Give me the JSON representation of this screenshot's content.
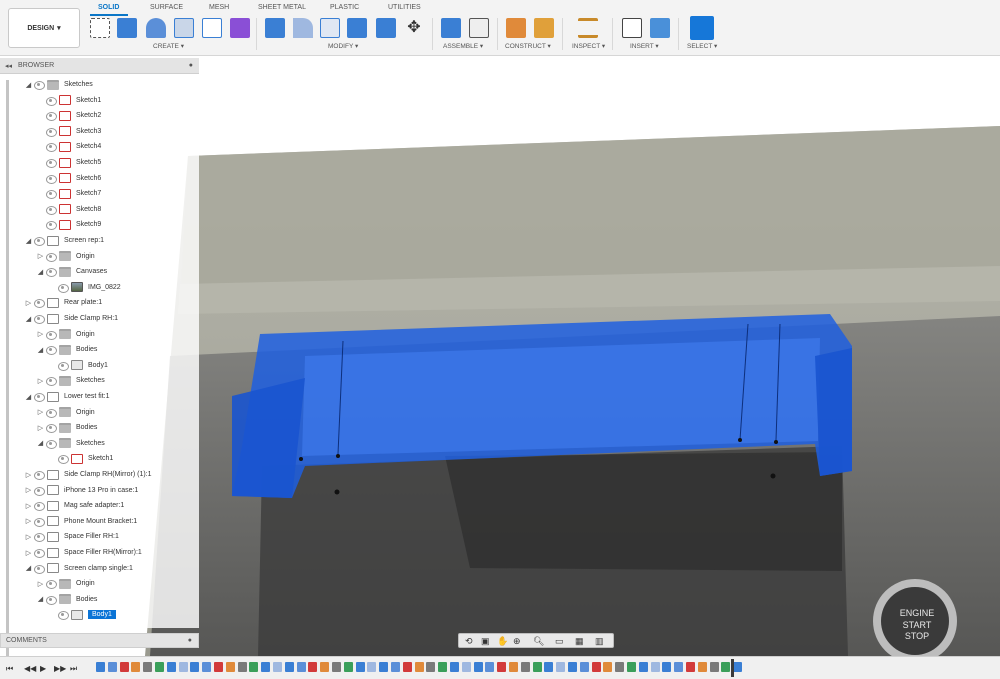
{
  "toolbar": {
    "workspace": "DESIGN",
    "tabs": [
      "SOLID",
      "SURFACE",
      "MESH",
      "SHEET METAL",
      "PLASTIC",
      "UTILITIES"
    ],
    "active_tab": "SOLID",
    "groups": [
      "CREATE ▾",
      "MODIFY ▾",
      "ASSEMBLE ▾",
      "CONSTRUCT ▾",
      "INSPECT ▾",
      "INSERT ▾",
      "SELECT ▾"
    ]
  },
  "browser": {
    "title": "BROWSER",
    "rows": [
      {
        "label": "Sketches",
        "type": "folder",
        "arrow": "◢"
      },
      {
        "label": "Sketch1",
        "type": "sketch",
        "arrow": ""
      },
      {
        "label": "Sketch2",
        "type": "sketch",
        "arrow": ""
      },
      {
        "label": "Sketch3",
        "type": "sketch",
        "arrow": ""
      },
      {
        "label": "Sketch4",
        "type": "sketch",
        "arrow": ""
      },
      {
        "label": "Sketch5",
        "type": "sketch",
        "arrow": ""
      },
      {
        "label": "Sketch6",
        "type": "sketch",
        "arrow": ""
      },
      {
        "label": "Sketch7",
        "type": "sketch",
        "arrow": ""
      },
      {
        "label": "Sketch8",
        "type": "sketch",
        "arrow": ""
      },
      {
        "label": "Sketch9",
        "type": "sketch",
        "arrow": ""
      },
      {
        "label": "Screen rep:1",
        "type": "comp",
        "arrow": "◢"
      },
      {
        "label": "Origin",
        "type": "folder",
        "arrow": "▷"
      },
      {
        "label": "Canvases",
        "type": "folder",
        "arrow": "◢"
      },
      {
        "label": "IMG_0822",
        "type": "canvas",
        "arrow": ""
      },
      {
        "label": "Rear plate:1",
        "type": "comp",
        "arrow": "▷"
      },
      {
        "label": "Side Clamp RH:1",
        "type": "comp",
        "arrow": "◢"
      },
      {
        "label": "Origin",
        "type": "folder",
        "arrow": "▷"
      },
      {
        "label": "Bodies",
        "type": "folder",
        "arrow": "◢"
      },
      {
        "label": "Body1",
        "type": "body",
        "arrow": ""
      },
      {
        "label": "Sketches",
        "type": "folder",
        "arrow": "▷"
      },
      {
        "label": "Lower test fit:1",
        "type": "comp",
        "arrow": "◢"
      },
      {
        "label": "Origin",
        "type": "folder",
        "arrow": "▷"
      },
      {
        "label": "Bodies",
        "type": "folder",
        "arrow": "▷"
      },
      {
        "label": "Sketches",
        "type": "folder",
        "arrow": "◢"
      },
      {
        "label": "Sketch1",
        "type": "sketch",
        "arrow": ""
      },
      {
        "label": "Side Clamp RH(Mirror) (1):1",
        "type": "comp",
        "arrow": "▷"
      },
      {
        "label": "iPhone 13 Pro in case:1",
        "type": "comp",
        "arrow": "▷"
      },
      {
        "label": "Mag safe adapter:1",
        "type": "comp",
        "arrow": "▷"
      },
      {
        "label": "Phone Mount Bracket:1",
        "type": "comp",
        "arrow": "▷"
      },
      {
        "label": "Space Filler RH:1",
        "type": "comp",
        "arrow": "▷"
      },
      {
        "label": "Space Filler RH(Mirror):1",
        "type": "comp",
        "arrow": "▷"
      },
      {
        "label": "Screen clamp single:1",
        "type": "comp",
        "arrow": "◢"
      },
      {
        "label": "Origin",
        "type": "folder",
        "arrow": "▷"
      },
      {
        "label": "Bodies",
        "type": "folder",
        "arrow": "◢"
      },
      {
        "label": "Body1",
        "type": "body",
        "arrow": "",
        "selected": true
      }
    ]
  },
  "comments": {
    "title": "COMMENTS"
  },
  "viewport": {
    "button_text": [
      "ENGINE",
      "START",
      "STOP"
    ],
    "model_color": "#1f5fe0"
  },
  "colors": {
    "accent": "#0a76c7",
    "selection": "#0b74d6"
  }
}
